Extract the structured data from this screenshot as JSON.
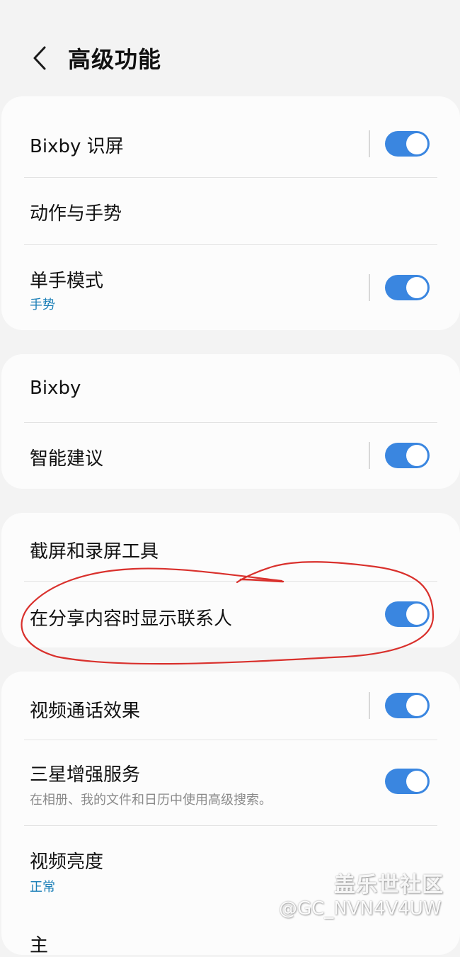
{
  "header": {
    "title": "高级功能"
  },
  "card1": {
    "bixby_vision": {
      "title": "Bixby 识屏",
      "toggle_on": true
    },
    "motions": {
      "title": "动作与手势"
    },
    "one_hand": {
      "title": "单手模式",
      "subtitle": "手势",
      "toggle_on": true
    }
  },
  "card2": {
    "bixby": {
      "title": "Bixby"
    },
    "smart_suggestions": {
      "title": "智能建议",
      "toggle_on": true
    }
  },
  "card3": {
    "screenshots": {
      "title": "截屏和录屏工具"
    },
    "share_contacts": {
      "title": "在分享内容时显示联系人",
      "toggle_on": true
    }
  },
  "card4": {
    "video_call": {
      "title": "视频通话效果",
      "toggle_on": true
    },
    "samsung_enhanced": {
      "title": "三星增强服务",
      "description": "在相册、我的文件和日历中使用高级搜索。",
      "toggle_on": true
    },
    "video_brightness": {
      "title": "视频亮度",
      "subtitle": "正常"
    },
    "partial_next": {
      "title": "主"
    }
  },
  "watermark": {
    "community": "盖乐世社区",
    "user": "@GC_NVN4V4UW"
  },
  "colors": {
    "toggle_on": "#3a86e0",
    "accent_text": "#1b7fb7",
    "annotation": "#d9302c"
  }
}
